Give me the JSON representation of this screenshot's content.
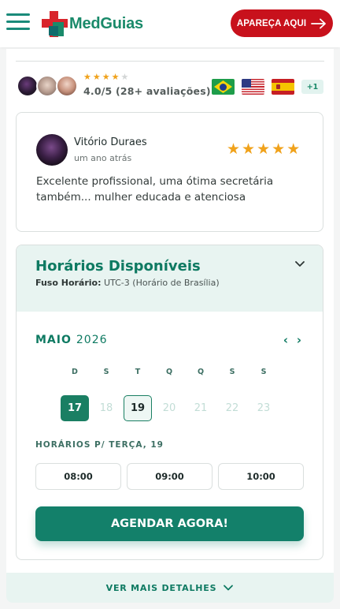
{
  "header": {
    "logo_text": "MedGuias",
    "cta_label": "APAREÇA AQUI"
  },
  "rating": {
    "stars_filled": 4,
    "stars_total": 5,
    "text": "4.0/5 (28+ avaliações)",
    "more_languages": "+1"
  },
  "review": {
    "name": "Vitório Duraes",
    "time": "um ano atrás",
    "stars": 5,
    "text": "Excelente profissional, uma ótima secretária também... mulher educada e atenciosa"
  },
  "schedule": {
    "title": "Horários Disponíveis",
    "timezone_label": "Fuso Horário:",
    "timezone_value": "UTC-3 (Horário de Brasília)",
    "month": "MAIO",
    "year": "2026",
    "prev": "‹",
    "next": "›",
    "weekdays": [
      "D",
      "S",
      "T",
      "Q",
      "Q",
      "S",
      "S"
    ],
    "days": [
      "17",
      "18",
      "19",
      "20",
      "21",
      "22",
      "23"
    ],
    "slots_title": "HORÁRIOS P/ TERÇA, 19",
    "slots": [
      "08:00",
      "09:00",
      "10:00"
    ],
    "cta_label": "AGENDAR AGORA!"
  },
  "details_label": "VER MAIS DETALHES",
  "colors": {
    "brand_green": "#1a8a6a",
    "brand_red": "#c8111c",
    "star": "#f0a21b",
    "panel_bg": "#e8f4f1"
  }
}
